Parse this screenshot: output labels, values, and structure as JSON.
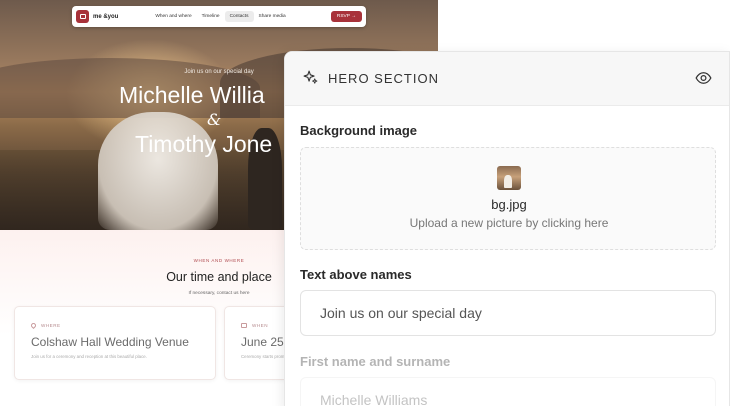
{
  "site": {
    "brand": "me &you",
    "nav": {
      "links": [
        "When and where",
        "Timeline",
        "Contacts",
        "Share media"
      ],
      "active_index": 2,
      "rsvp_label": "RSVP →"
    },
    "hero": {
      "subtitle": "Join us on our special day",
      "name1": "Michelle Willia",
      "amp": "&",
      "name2": "Timothy Jone"
    },
    "section": {
      "eyebrow": "WHEN AND WHERE",
      "title": "Our time and place",
      "subtitle": "If necessary, contact us here"
    },
    "cards": [
      {
        "label": "WHERE",
        "value": "Colshaw Hall Wedding Venue",
        "desc": "Join us for a ceremony and reception at this beautiful place."
      },
      {
        "label": "WHEN",
        "value": "June 25",
        "desc": "Ceremony starts prom"
      }
    ]
  },
  "panel": {
    "title": "HERO SECTION",
    "background": {
      "label": "Background image",
      "file_name": "bg.jpg",
      "hint": "Upload a new picture by clicking here"
    },
    "text_above": {
      "label": "Text above names",
      "value": "Join us on our special day"
    },
    "names": {
      "label": "First name and surname",
      "value": "Michelle Williams"
    }
  },
  "colors": {
    "brand": "#a8323a",
    "panel_header": "#f7f7f7"
  }
}
